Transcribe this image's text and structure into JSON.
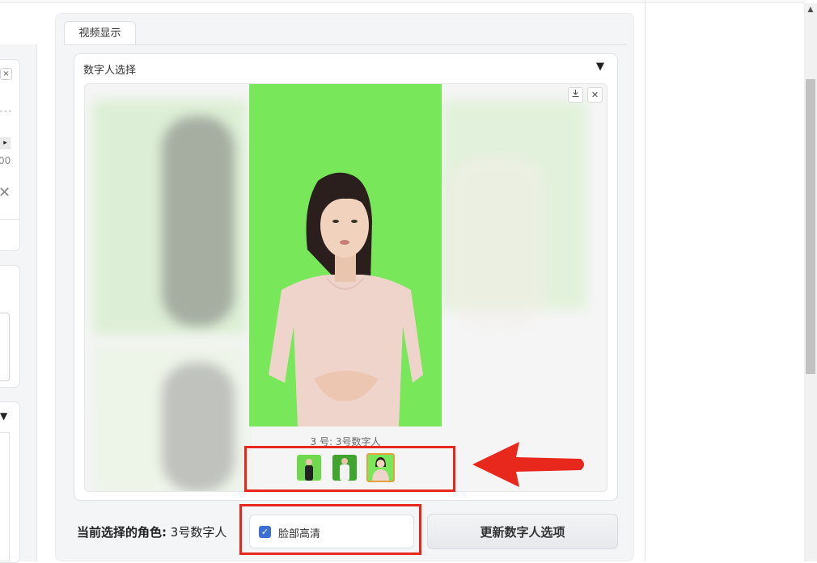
{
  "tab": {
    "label": "视频显示"
  },
  "card": {
    "title": "数字人选择",
    "toggle_icon": "▼"
  },
  "gallery": {
    "download_icon": "download-icon",
    "close_icon": "close-icon",
    "selected_caption": "3 号: 3号数字人",
    "thumbnails": [
      {
        "name": "avatar-1",
        "selected": false
      },
      {
        "name": "avatar-2",
        "selected": false
      },
      {
        "name": "avatar-3",
        "selected": true
      }
    ]
  },
  "current_role": {
    "label": "当前选择的角色:",
    "value": "3号数字人"
  },
  "face_hd": {
    "label": "脸部高清",
    "checked": true
  },
  "update_button": {
    "label": "更新数字人选项"
  },
  "left_panel": {
    "close_symbol": "×",
    "play_symbol": "▸",
    "value_fragment": "00",
    "dropdown_symbol": "▼"
  },
  "colors": {
    "greenscreen": "#78e85a",
    "accent": "#3b6fd6",
    "annotation_red": "#e8271d"
  }
}
